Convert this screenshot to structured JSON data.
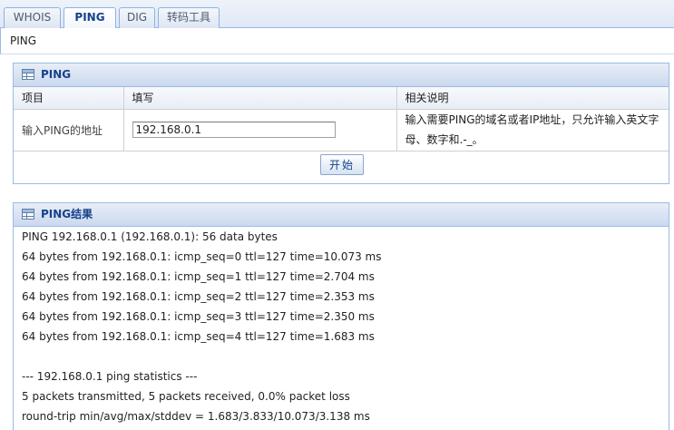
{
  "tabs": [
    {
      "label": "WHOIS"
    },
    {
      "label": "PING"
    },
    {
      "label": "DIG"
    },
    {
      "label": "转码工具"
    }
  ],
  "active_tab": "PING",
  "page_title": "PING",
  "ping_panel": {
    "title": "PING",
    "columns": [
      "项目",
      "填写",
      "相关说明"
    ],
    "row": {
      "label": "输入PING的地址",
      "input_value": "192.168.0.1",
      "description": "输入需要PING的域名或者IP地址，只允许输入英文字母、数字和.-_。"
    },
    "start_label": "开始"
  },
  "result_panel": {
    "title": "PING结果",
    "lines": [
      "PING 192.168.0.1 (192.168.0.1): 56 data bytes",
      "64 bytes from 192.168.0.1: icmp_seq=0 ttl=127 time=10.073 ms",
      "64 bytes from 192.168.0.1: icmp_seq=1 ttl=127 time=2.704 ms",
      "64 bytes from 192.168.0.1: icmp_seq=2 ttl=127 time=2.353 ms",
      "64 bytes from 192.168.0.1: icmp_seq=3 ttl=127 time=2.350 ms",
      "64 bytes from 192.168.0.1: icmp_seq=4 ttl=127 time=1.683 ms",
      "",
      "--- 192.168.0.1 ping statistics ---",
      "5 packets transmitted, 5 packets received, 0.0% packet loss",
      "round-trip min/avg/max/stddev = 1.683/3.833/10.073/3.138 ms"
    ]
  },
  "colors": {
    "accent": "#15428b",
    "border": "#99bbe8",
    "header_bg": "#dfe8f6"
  }
}
